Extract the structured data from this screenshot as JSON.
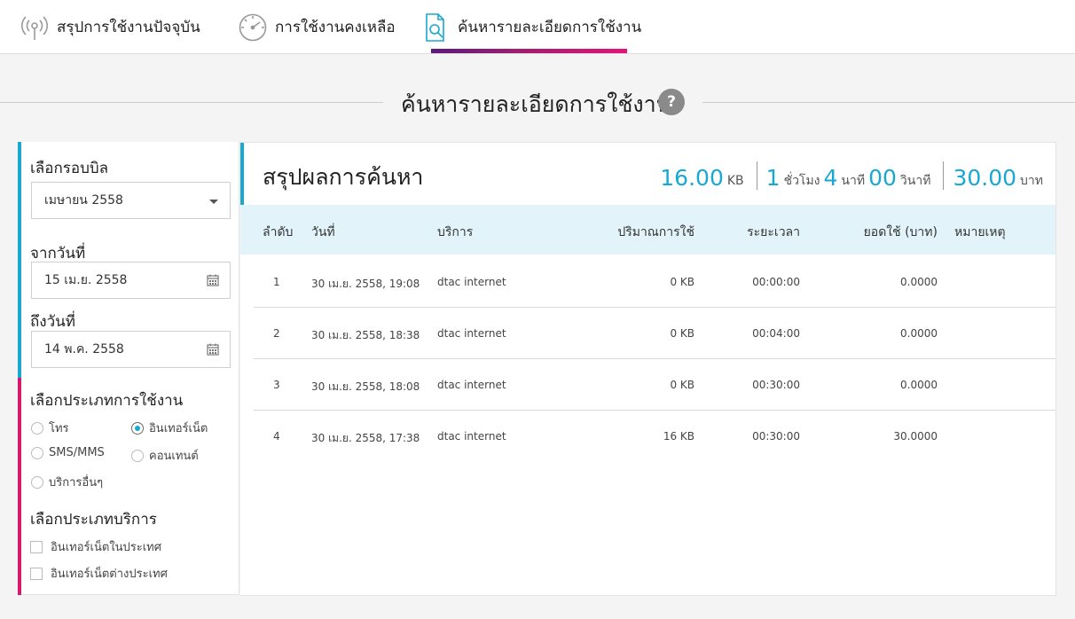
{
  "tabs": [
    {
      "label": "สรุปการใช้งานปัจจุบัน",
      "icon": "signal-icon"
    },
    {
      "label": "การใช้งานคงเหลือ",
      "icon": "gauge-icon"
    },
    {
      "label": "ค้นหารายละเอียดการใช้งาน",
      "icon": "document-search-icon",
      "active": true
    }
  ],
  "page": {
    "title": "ค้นหารายละเอียดการใช้งาน",
    "help": "?"
  },
  "filters": {
    "bill_cycle_label": "เลือกรอบบิล",
    "bill_cycle_value": "เมษายน 2558",
    "from_label": "จากวันที่",
    "from_value": "15 เม.ย. 2558",
    "to_label": "ถึงวันที่",
    "to_value": "14 พ.ค. 2558",
    "usage_type_label": "เลือกประเภทการใช้งาน",
    "usage_types": [
      {
        "label": "โทร",
        "selected": false
      },
      {
        "label": "อินเทอร์เน็ต",
        "selected": true
      },
      {
        "label": "SMS/MMS",
        "selected": false
      },
      {
        "label": "คอนเทนต์",
        "selected": false
      },
      {
        "label": "บริการอื่นๆ",
        "selected": false
      }
    ],
    "service_type_label": "เลือกประเภทบริการ",
    "service_types": [
      {
        "label": "อินเทอร์เน็ตในประเทศ",
        "checked": false
      },
      {
        "label": "อินเทอร์เน็ตต่างประเทศ",
        "checked": false
      }
    ]
  },
  "summary": {
    "title": "สรุปผลการค้นหา",
    "data_value": "16.00",
    "data_unit": "KB",
    "hours_value": "1",
    "hours_unit": "ชั่วโมง",
    "minutes_value": "4",
    "minutes_unit": "นาที",
    "seconds_value": "00",
    "seconds_unit": "วินาที",
    "cost_value": "30.00",
    "cost_unit": "บาท"
  },
  "table": {
    "headers": [
      "ลำดับ",
      "วันที่",
      "บริการ",
      "ปริมาณการใช้",
      "ระยะเวลา",
      "ยอดใช้ (บาท)",
      "หมายเหตุ"
    ],
    "rows": [
      [
        "1",
        "30 เม.ย. 2558, 19:08",
        "dtac internet",
        "0 KB",
        "00:00:00",
        "0.0000",
        ""
      ],
      [
        "2",
        "30 เม.ย. 2558, 18:38",
        "dtac internet",
        "0 KB",
        "00:04:00",
        "0.0000",
        ""
      ],
      [
        "3",
        "30 เม.ย. 2558, 18:08",
        "dtac internet",
        "0 KB",
        "00:30:00",
        "0.0000",
        ""
      ],
      [
        "4",
        "30 เม.ย. 2558, 17:38",
        "dtac internet",
        "16 KB",
        "00:30:00",
        "30.0000",
        ""
      ]
    ]
  },
  "colors": {
    "accent_blue": "#19a8d0",
    "accent_pink": "#d8176d",
    "header_bg": "#e3f3fa"
  }
}
